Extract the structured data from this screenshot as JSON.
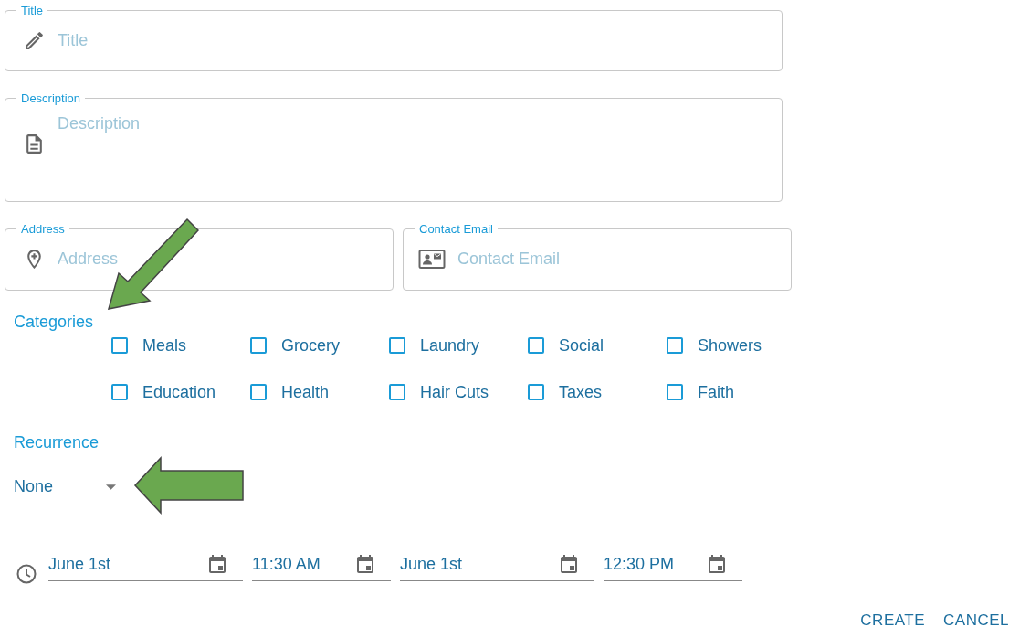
{
  "fields": [
    {
      "label": "Title",
      "placeholder": "Title",
      "kind": "line"
    },
    {
      "label": "Description",
      "placeholder": "Description",
      "kind": "area"
    }
  ],
  "pair_fields": [
    {
      "label": "Address",
      "placeholder": "Address"
    },
    {
      "label": "Contact Email",
      "placeholder": "Contact Email"
    }
  ],
  "categories": {
    "label": "Categories",
    "options": [
      {
        "label": "Meals",
        "checked": false
      },
      {
        "label": "Grocery",
        "checked": false
      },
      {
        "label": "Laundry",
        "checked": false
      },
      {
        "label": "Social",
        "checked": false
      },
      {
        "label": "Showers",
        "checked": false
      },
      {
        "label": "Education",
        "checked": false
      },
      {
        "label": "Health",
        "checked": false
      },
      {
        "label": "Hair Cuts",
        "checked": false
      },
      {
        "label": "Taxes",
        "checked": false
      },
      {
        "label": "Faith",
        "checked": false
      }
    ]
  },
  "recurrence": {
    "label": "Recurrence",
    "value": "None"
  },
  "schedule": [
    {
      "value": "June 1st",
      "kind": "date"
    },
    {
      "value": "11:30 AM",
      "kind": "time"
    },
    {
      "value": "June 1st",
      "kind": "date"
    },
    {
      "value": "12:30 PM",
      "kind": "time"
    }
  ],
  "buttons": [
    "CREATE",
    "CANCEL"
  ]
}
